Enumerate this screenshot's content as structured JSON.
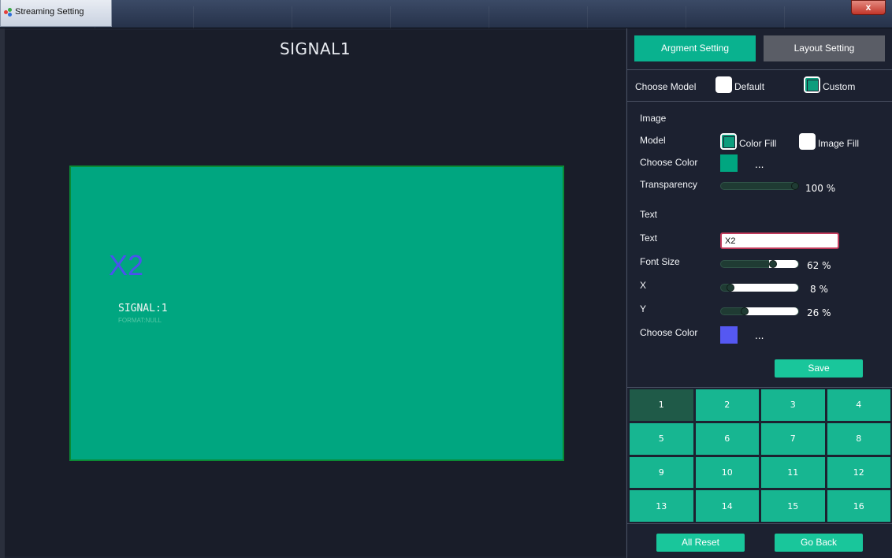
{
  "window": {
    "title": "Streaming Setting",
    "close_label": "x"
  },
  "preview": {
    "title": "SIGNAL1",
    "overlay_text": "X2",
    "signal_label": "SIGNAL:1",
    "format_label": "FORMAT:NULL",
    "colors": {
      "canvas": "#00a680",
      "overlay_text": "#4b52ee"
    }
  },
  "tabs": {
    "argment": "Argment Setting",
    "layout": "Layout Setting",
    "active": "argment"
  },
  "model": {
    "label": "Choose Model",
    "default_label": "Default",
    "custom_label": "Custom",
    "selected": "custom"
  },
  "image": {
    "section_label": "Image",
    "model_label": "Model",
    "color_fill_label": "Color Fill",
    "image_fill_label": "Image Fill",
    "selected_fill": "color_fill",
    "choose_color_label": "Choose Color",
    "color": "#00a680",
    "color_dots": "...",
    "transparency_label": "Transparency",
    "transparency_value": 100,
    "transparency_text": "100 %"
  },
  "text": {
    "section_label": "Text",
    "text_label": "Text",
    "text_value": "X2",
    "font_size_label": "Font Size",
    "font_size_value": 62,
    "font_size_text": "62 %",
    "x_label": "X",
    "x_value": 8,
    "x_text": "8 %",
    "y_label": "Y",
    "y_value": 26,
    "y_text": "26 %",
    "choose_color_label": "Choose Color",
    "color": "#5558f2",
    "color_dots": "..."
  },
  "save_label": "Save",
  "grid": {
    "cells": [
      "1",
      "2",
      "3",
      "4",
      "5",
      "6",
      "7",
      "8",
      "9",
      "10",
      "11",
      "12",
      "13",
      "14",
      "15",
      "16"
    ],
    "selected": "1"
  },
  "footer": {
    "all_reset_label": "All Reset",
    "go_back_label": "Go Back"
  }
}
